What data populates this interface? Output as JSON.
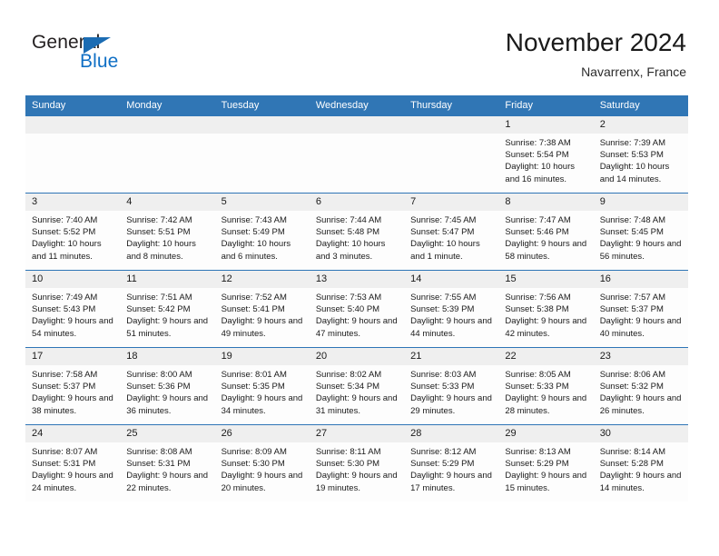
{
  "brand": {
    "name_part1": "General",
    "name_part2": "Blue",
    "logo_icon": "triangle-icon",
    "accent_color": "#0f6fc5"
  },
  "header": {
    "title": "November 2024",
    "subtitle": "Navarrenx, France"
  },
  "theme": {
    "header_row_bg": "#3076b5",
    "day_band_bg": "#efefef",
    "cell_border": "#2e75b6",
    "cell_bg": "#fdfdfd"
  },
  "weekday_headers": [
    "Sunday",
    "Monday",
    "Tuesday",
    "Wednesday",
    "Thursday",
    "Friday",
    "Saturday"
  ],
  "weeks": [
    [
      {
        "day": "",
        "empty": true
      },
      {
        "day": "",
        "empty": true
      },
      {
        "day": "",
        "empty": true
      },
      {
        "day": "",
        "empty": true
      },
      {
        "day": "",
        "empty": true
      },
      {
        "day": "1",
        "sunrise": "Sunrise: 7:38 AM",
        "sunset": "Sunset: 5:54 PM",
        "daylight": "Daylight: 10 hours and 16 minutes."
      },
      {
        "day": "2",
        "sunrise": "Sunrise: 7:39 AM",
        "sunset": "Sunset: 5:53 PM",
        "daylight": "Daylight: 10 hours and 14 minutes."
      }
    ],
    [
      {
        "day": "3",
        "sunrise": "Sunrise: 7:40 AM",
        "sunset": "Sunset: 5:52 PM",
        "daylight": "Daylight: 10 hours and 11 minutes."
      },
      {
        "day": "4",
        "sunrise": "Sunrise: 7:42 AM",
        "sunset": "Sunset: 5:51 PM",
        "daylight": "Daylight: 10 hours and 8 minutes."
      },
      {
        "day": "5",
        "sunrise": "Sunrise: 7:43 AM",
        "sunset": "Sunset: 5:49 PM",
        "daylight": "Daylight: 10 hours and 6 minutes."
      },
      {
        "day": "6",
        "sunrise": "Sunrise: 7:44 AM",
        "sunset": "Sunset: 5:48 PM",
        "daylight": "Daylight: 10 hours and 3 minutes."
      },
      {
        "day": "7",
        "sunrise": "Sunrise: 7:45 AM",
        "sunset": "Sunset: 5:47 PM",
        "daylight": "Daylight: 10 hours and 1 minute."
      },
      {
        "day": "8",
        "sunrise": "Sunrise: 7:47 AM",
        "sunset": "Sunset: 5:46 PM",
        "daylight": "Daylight: 9 hours and 58 minutes."
      },
      {
        "day": "9",
        "sunrise": "Sunrise: 7:48 AM",
        "sunset": "Sunset: 5:45 PM",
        "daylight": "Daylight: 9 hours and 56 minutes."
      }
    ],
    [
      {
        "day": "10",
        "sunrise": "Sunrise: 7:49 AM",
        "sunset": "Sunset: 5:43 PM",
        "daylight": "Daylight: 9 hours and 54 minutes."
      },
      {
        "day": "11",
        "sunrise": "Sunrise: 7:51 AM",
        "sunset": "Sunset: 5:42 PM",
        "daylight": "Daylight: 9 hours and 51 minutes."
      },
      {
        "day": "12",
        "sunrise": "Sunrise: 7:52 AM",
        "sunset": "Sunset: 5:41 PM",
        "daylight": "Daylight: 9 hours and 49 minutes."
      },
      {
        "day": "13",
        "sunrise": "Sunrise: 7:53 AM",
        "sunset": "Sunset: 5:40 PM",
        "daylight": "Daylight: 9 hours and 47 minutes."
      },
      {
        "day": "14",
        "sunrise": "Sunrise: 7:55 AM",
        "sunset": "Sunset: 5:39 PM",
        "daylight": "Daylight: 9 hours and 44 minutes."
      },
      {
        "day": "15",
        "sunrise": "Sunrise: 7:56 AM",
        "sunset": "Sunset: 5:38 PM",
        "daylight": "Daylight: 9 hours and 42 minutes."
      },
      {
        "day": "16",
        "sunrise": "Sunrise: 7:57 AM",
        "sunset": "Sunset: 5:37 PM",
        "daylight": "Daylight: 9 hours and 40 minutes."
      }
    ],
    [
      {
        "day": "17",
        "sunrise": "Sunrise: 7:58 AM",
        "sunset": "Sunset: 5:37 PM",
        "daylight": "Daylight: 9 hours and 38 minutes."
      },
      {
        "day": "18",
        "sunrise": "Sunrise: 8:00 AM",
        "sunset": "Sunset: 5:36 PM",
        "daylight": "Daylight: 9 hours and 36 minutes."
      },
      {
        "day": "19",
        "sunrise": "Sunrise: 8:01 AM",
        "sunset": "Sunset: 5:35 PM",
        "daylight": "Daylight: 9 hours and 34 minutes."
      },
      {
        "day": "20",
        "sunrise": "Sunrise: 8:02 AM",
        "sunset": "Sunset: 5:34 PM",
        "daylight": "Daylight: 9 hours and 31 minutes."
      },
      {
        "day": "21",
        "sunrise": "Sunrise: 8:03 AM",
        "sunset": "Sunset: 5:33 PM",
        "daylight": "Daylight: 9 hours and 29 minutes."
      },
      {
        "day": "22",
        "sunrise": "Sunrise: 8:05 AM",
        "sunset": "Sunset: 5:33 PM",
        "daylight": "Daylight: 9 hours and 28 minutes."
      },
      {
        "day": "23",
        "sunrise": "Sunrise: 8:06 AM",
        "sunset": "Sunset: 5:32 PM",
        "daylight": "Daylight: 9 hours and 26 minutes."
      }
    ],
    [
      {
        "day": "24",
        "sunrise": "Sunrise: 8:07 AM",
        "sunset": "Sunset: 5:31 PM",
        "daylight": "Daylight: 9 hours and 24 minutes."
      },
      {
        "day": "25",
        "sunrise": "Sunrise: 8:08 AM",
        "sunset": "Sunset: 5:31 PM",
        "daylight": "Daylight: 9 hours and 22 minutes."
      },
      {
        "day": "26",
        "sunrise": "Sunrise: 8:09 AM",
        "sunset": "Sunset: 5:30 PM",
        "daylight": "Daylight: 9 hours and 20 minutes."
      },
      {
        "day": "27",
        "sunrise": "Sunrise: 8:11 AM",
        "sunset": "Sunset: 5:30 PM",
        "daylight": "Daylight: 9 hours and 19 minutes."
      },
      {
        "day": "28",
        "sunrise": "Sunrise: 8:12 AM",
        "sunset": "Sunset: 5:29 PM",
        "daylight": "Daylight: 9 hours and 17 minutes."
      },
      {
        "day": "29",
        "sunrise": "Sunrise: 8:13 AM",
        "sunset": "Sunset: 5:29 PM",
        "daylight": "Daylight: 9 hours and 15 minutes."
      },
      {
        "day": "30",
        "sunrise": "Sunrise: 8:14 AM",
        "sunset": "Sunset: 5:28 PM",
        "daylight": "Daylight: 9 hours and 14 minutes."
      }
    ]
  ]
}
